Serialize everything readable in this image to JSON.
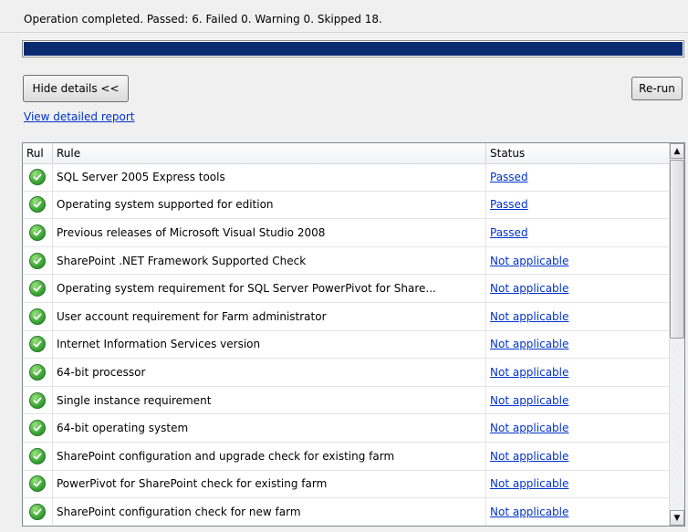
{
  "summary": {
    "text": "Operation completed. Passed: 6.   Failed 0.   Warning 0.   Skipped 18."
  },
  "progress": {
    "fraction": 1.0,
    "fill_color": "#0a2a70"
  },
  "buttons": {
    "hide_details": "Hide details <<",
    "rerun": "Re-run"
  },
  "links": {
    "detailed_report": "View detailed report"
  },
  "table": {
    "columns": [
      "Rul",
      "Rule",
      "Status"
    ],
    "rows": [
      {
        "rule": "SQL Server 2005 Express tools",
        "status": "Passed"
      },
      {
        "rule": "Operating system supported for edition",
        "status": "Passed"
      },
      {
        "rule": "Previous releases of Microsoft Visual Studio 2008",
        "status": "Passed"
      },
      {
        "rule": "SharePoint .NET Framework Supported Check",
        "status": "Not applicable"
      },
      {
        "rule": "Operating system requirement for SQL Server PowerPivot for Share...",
        "status": "Not applicable"
      },
      {
        "rule": "User account requirement for Farm administrator",
        "status": "Not applicable"
      },
      {
        "rule": "Internet Information Services version",
        "status": "Not applicable"
      },
      {
        "rule": "64-bit processor",
        "status": "Not applicable"
      },
      {
        "rule": "Single instance requirement",
        "status": "Not applicable"
      },
      {
        "rule": "64-bit operating system",
        "status": "Not applicable"
      },
      {
        "rule": "SharePoint configuration and upgrade check for existing farm",
        "status": "Not applicable"
      },
      {
        "rule": "PowerPivot for SharePoint check for existing farm",
        "status": "Not applicable"
      },
      {
        "rule": "SharePoint configuration check for new farm",
        "status": "Not applicable"
      }
    ],
    "row_icon": "check-circle-icon"
  },
  "scrollbar": {
    "up_icon": "scroll-up-arrow-icon",
    "down_icon": "scroll-down-arrow-icon"
  }
}
